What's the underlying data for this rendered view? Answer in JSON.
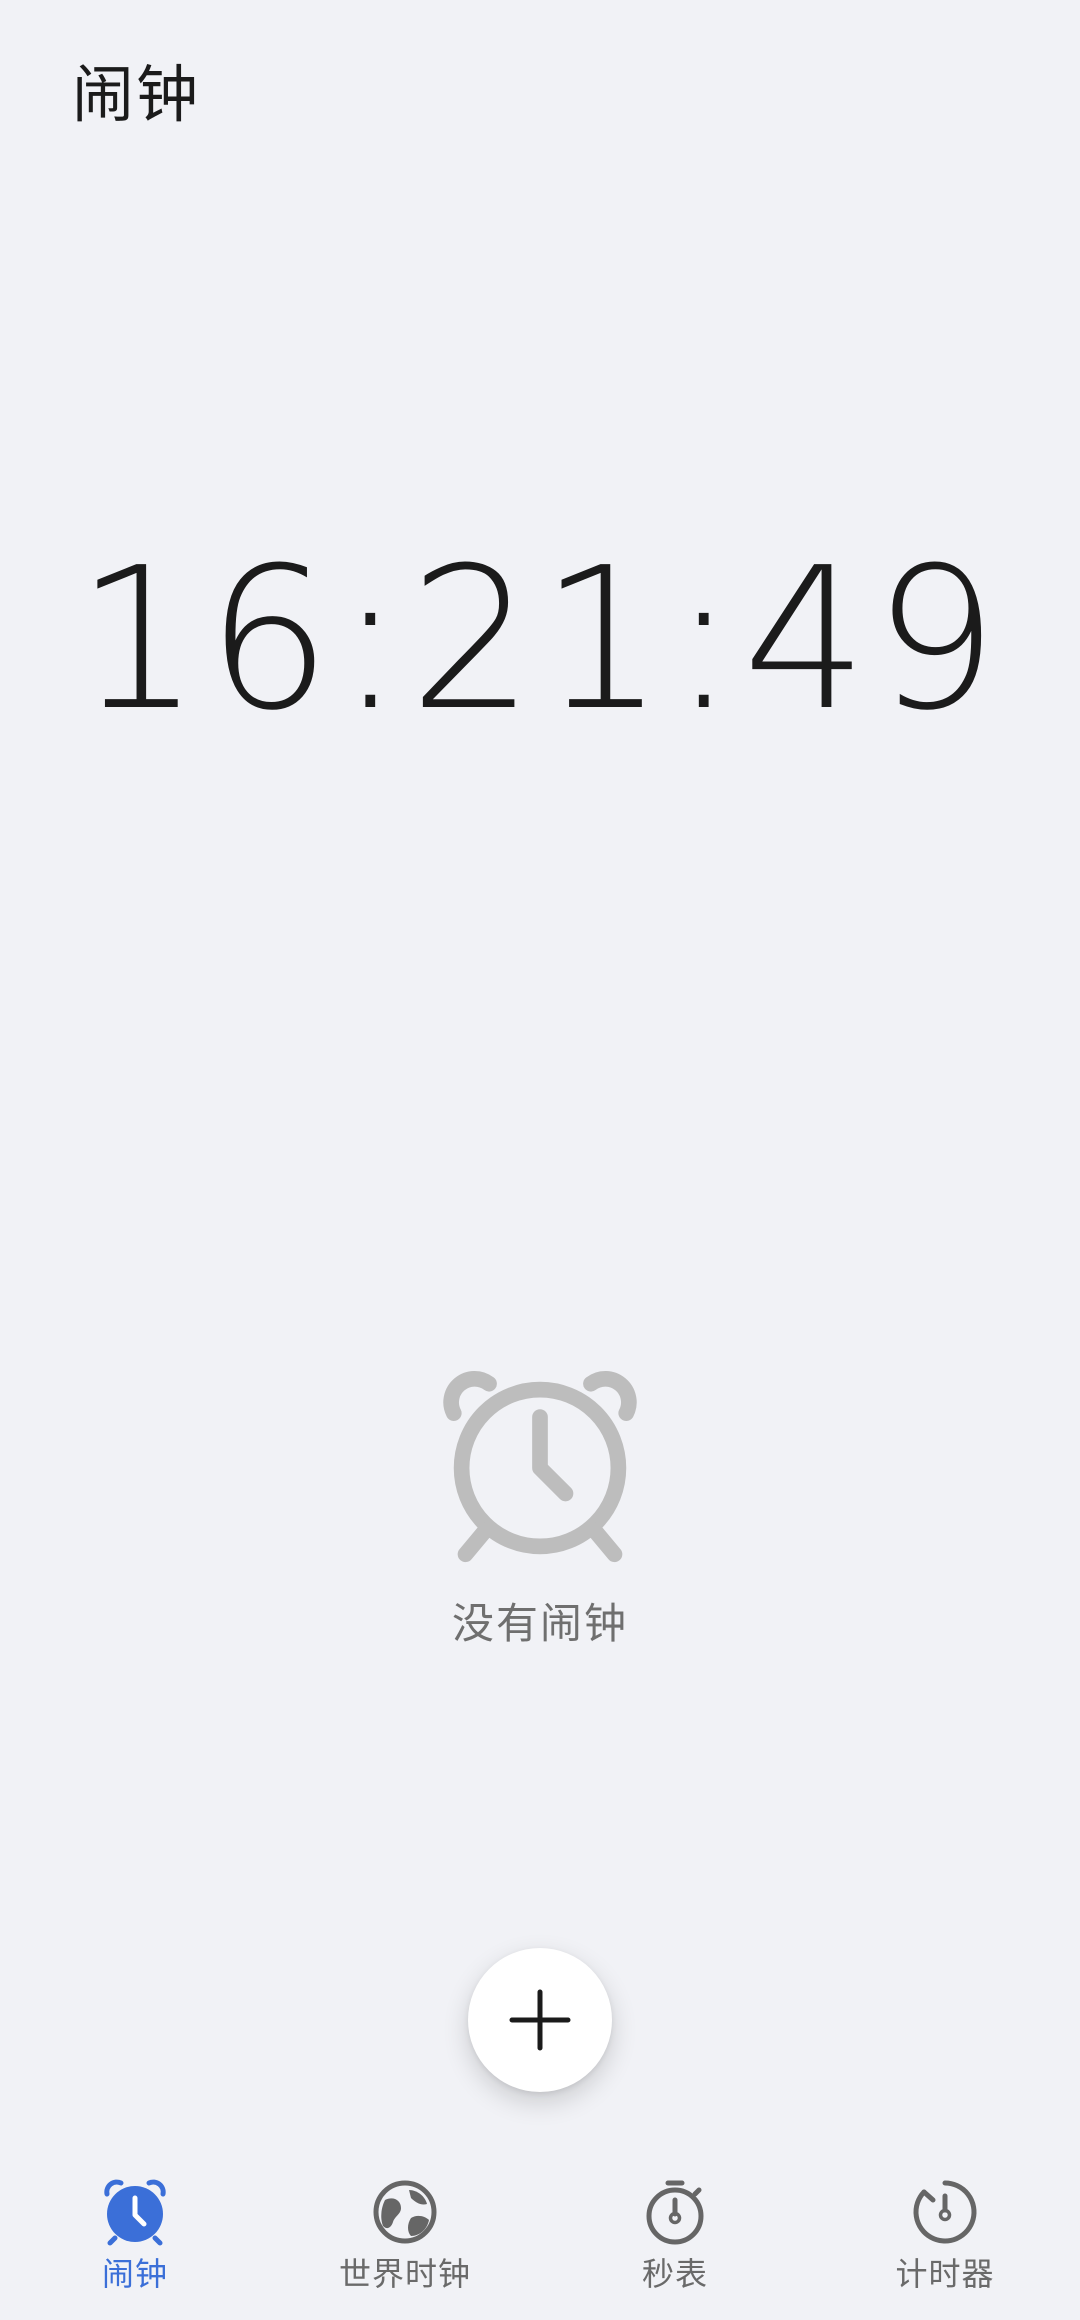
{
  "header": {
    "title": "闹钟"
  },
  "clock": {
    "time": "16:21:49"
  },
  "empty_state": {
    "icon": "alarm-clock-icon",
    "text": "没有闹钟"
  },
  "fab": {
    "icon": "plus-icon"
  },
  "tabs": [
    {
      "label": "闹钟",
      "icon": "alarm-clock-icon",
      "active": true
    },
    {
      "label": "世界时钟",
      "icon": "globe-icon",
      "active": false
    },
    {
      "label": "秒表",
      "icon": "stopwatch-icon",
      "active": false
    },
    {
      "label": "计时器",
      "icon": "timer-icon",
      "active": false
    }
  ],
  "colors": {
    "background": "#f1f2f6",
    "accent": "#3b6fd8",
    "text_primary": "#1b1b1b",
    "text_secondary": "#6a6a6a",
    "empty_icon": "#bdbdbd"
  }
}
